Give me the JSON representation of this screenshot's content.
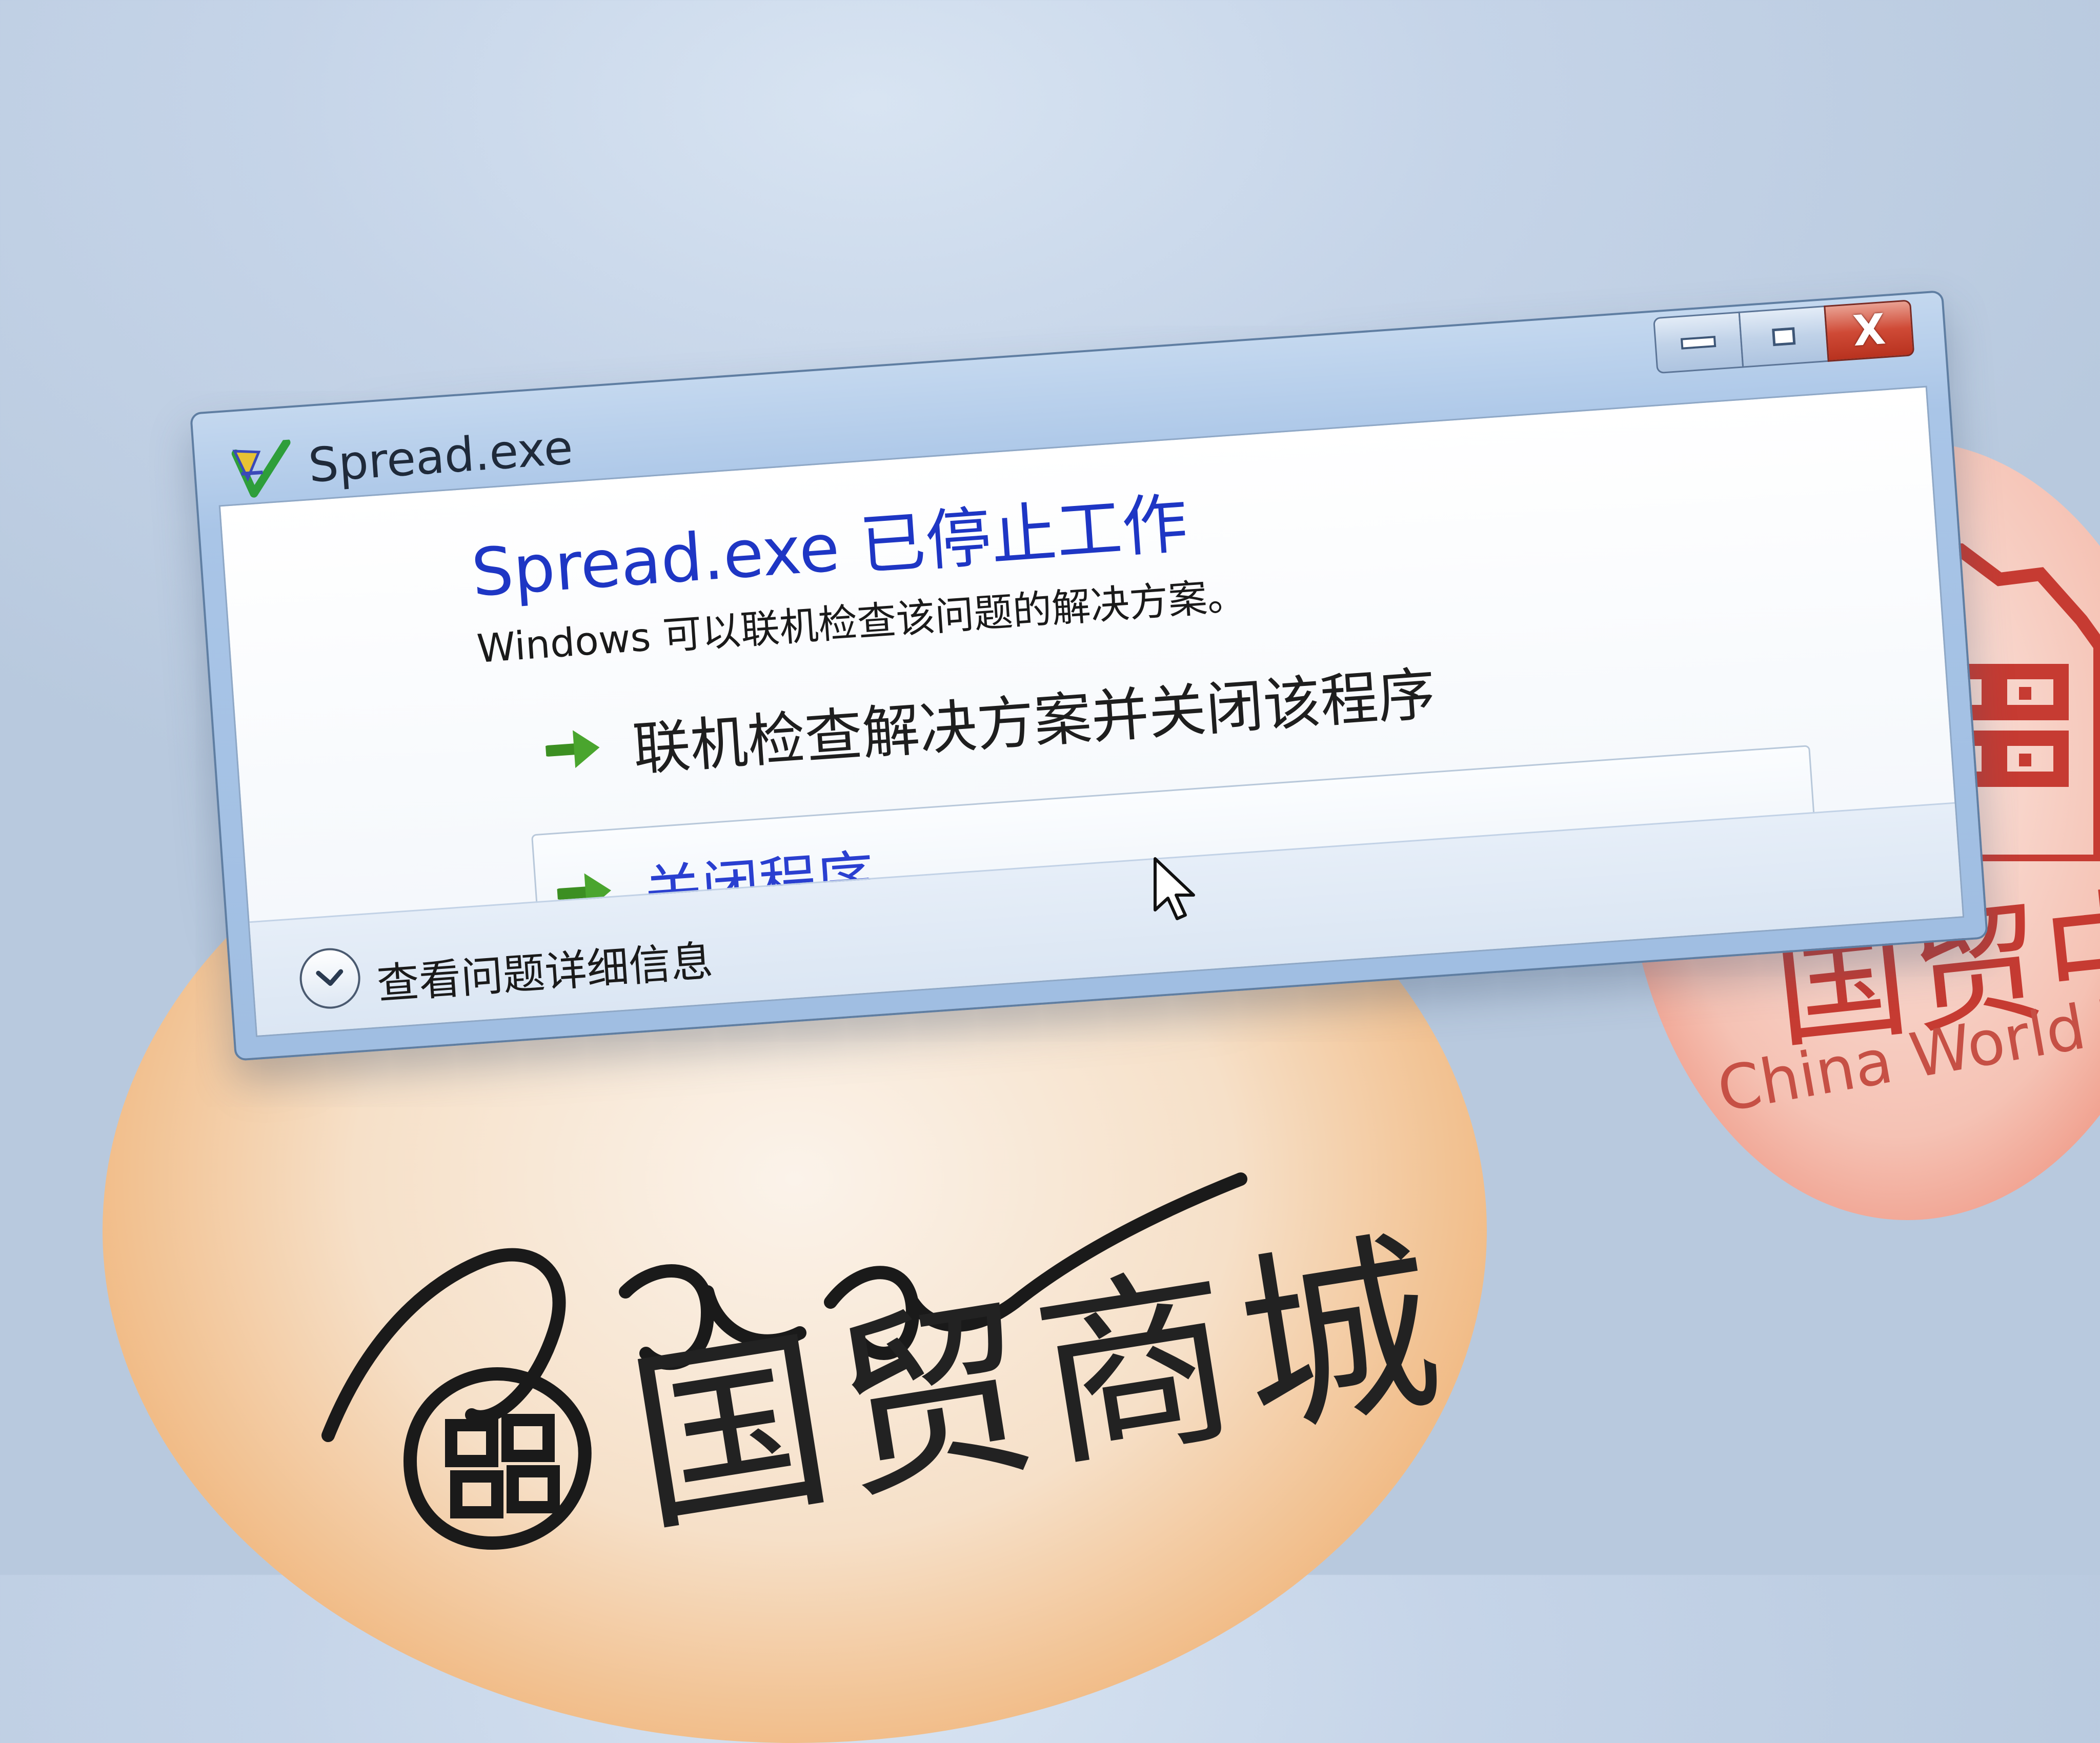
{
  "background": {
    "wallpaper_cn": "国贸商城",
    "right_cn": "国贸中",
    "right_en": "China World Trade C"
  },
  "dialog": {
    "title": "Spread.exe",
    "heading": "Spread.exe 已停止工作",
    "message": "Windows 可以联机检查该问题的解决方案。",
    "options": [
      {
        "label": "联机检查解决方案并关闭该程序",
        "icon": "green-arrow-icon"
      },
      {
        "label": "关闭程序",
        "icon": "green-arrow-icon"
      }
    ],
    "details_label": "查看问题详细信息",
    "controls": {
      "close": "X"
    }
  },
  "colors": {
    "heading": "#1e36c4",
    "link": "#2a3fd0",
    "close_button": "#cf4a36",
    "accent_arrow": "#4aa52e"
  }
}
